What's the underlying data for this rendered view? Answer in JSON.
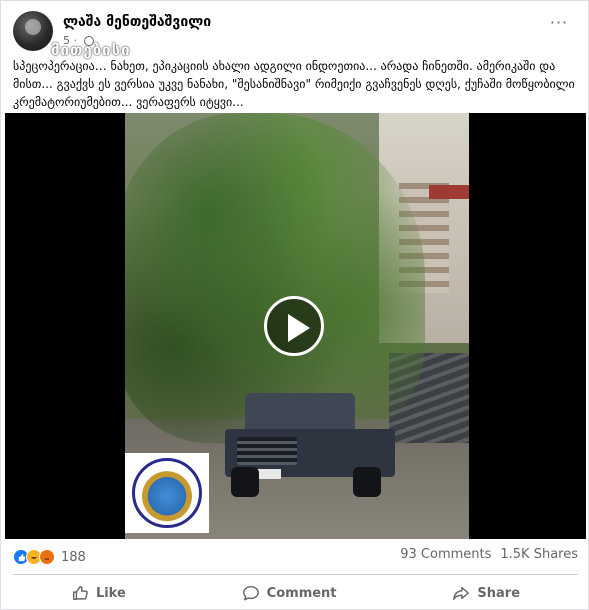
{
  "post": {
    "author_name": "ლაშა მენთეშაშვილი",
    "meta_text": "5 ·",
    "watermark_text": "მითებისი",
    "caption": "სპეცოპერაცია… ნახეთ, ეპიკაციის ახალი ადგილი ინდოეთია... არადა ჩინეთში. ამერიკაში და მისთ... გვაქვს ეს ვერსია უკვე ნანახი, \"შესანიშნავი\" რიმეიქი გვაჩვენეს დღეს, ქუჩაში მოწყობილი კრემატორიუმებით... ვერაფერს იტყვი...",
    "play_icon": "play-icon"
  },
  "stats": {
    "reaction_count": "188",
    "comments": "93 Comments",
    "shares": "1.5K Shares"
  },
  "actions": [
    {
      "label": "Like",
      "icon": "thumbs-up-icon"
    },
    {
      "label": "Comment",
      "icon": "comment-icon"
    },
    {
      "label": "Share",
      "icon": "share-icon"
    }
  ],
  "colors": {
    "like": "#1877f2",
    "haha": "#f7b125",
    "angry": "#e9710f",
    "muted_text": "#65676b"
  }
}
